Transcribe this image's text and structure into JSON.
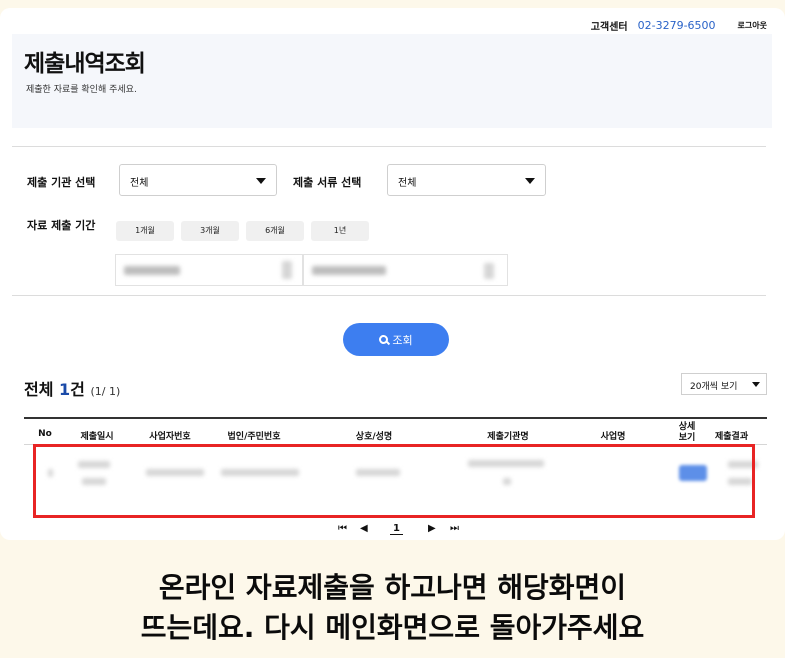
{
  "topbar": {
    "customer_center": "고객센터",
    "phone": "02-3279-6500",
    "logout": "로그아웃"
  },
  "header": {
    "title": "제출내역조회",
    "subtitle": "제출한 자료를 확인해 주세요."
  },
  "filters": {
    "agency_label": "제출 기관 선택",
    "agency_value": "전체",
    "doc_label": "제출 서류 선택",
    "doc_value": "전체",
    "period_label": "자료 제출 기간",
    "period_buttons": [
      "1개월",
      "3개월",
      "6개월",
      "1년"
    ]
  },
  "search_button": "조회",
  "results": {
    "total_prefix": "전체",
    "count": "1",
    "unit": "건",
    "pagination_info": "(1/ 1)",
    "per_page": "20개씩 보기"
  },
  "table": {
    "columns": [
      "No",
      "제출일시",
      "사업자번호",
      "법인/주민번호",
      "상호/성명",
      "제출기관명",
      "사업명",
      "상세보기",
      "제출결과"
    ]
  },
  "pager": {
    "first": "⏮",
    "prev": "◀",
    "current": "1",
    "next": "▶",
    "last": "⏭"
  },
  "caption": {
    "line1": "온라인 자료제출을 하고나면 해당화면이",
    "line2": "뜨는데요. 다시 메인화면으로 돌아가주세요"
  },
  "colors": {
    "accent": "#3d7ef0",
    "highlight": "#e82424",
    "background": "#fdf8ea"
  }
}
